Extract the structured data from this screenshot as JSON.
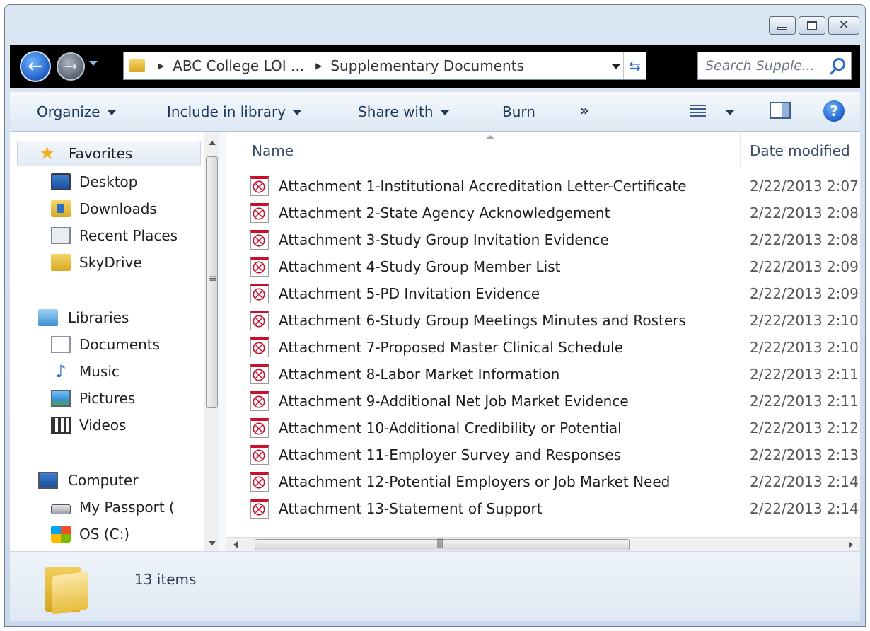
{
  "window": {
    "caption_buttons": [
      "minimize",
      "maximize",
      "close"
    ]
  },
  "address_bar": {
    "crumbs": [
      "ABC College LOI ...",
      "Supplementary Documents"
    ]
  },
  "search": {
    "placeholder": "Search Supple..."
  },
  "toolbar": {
    "organize": "Organize",
    "include_in_library": "Include in library",
    "share_with": "Share with",
    "burn": "Burn",
    "more": "»"
  },
  "navigation": {
    "favorites": "Favorites",
    "desktop": "Desktop",
    "downloads": "Downloads",
    "recent_places": "Recent Places",
    "skydrive": "SkyDrive",
    "libraries": "Libraries",
    "documents": "Documents",
    "music": "Music",
    "pictures": "Pictures",
    "videos": "Videos",
    "computer": "Computer",
    "my_passport": "My Passport (",
    "os_c": "OS (C:)"
  },
  "columns": {
    "name": "Name",
    "date_modified": "Date modified"
  },
  "files": [
    {
      "name": "Attachment 1-Institutional Accreditation Letter-Certificate",
      "date": "2/22/2013 2:07"
    },
    {
      "name": "Attachment 2-State Agency Acknowledgement",
      "date": "2/22/2013 2:08"
    },
    {
      "name": "Attachment 3-Study Group Invitation Evidence",
      "date": "2/22/2013 2:08"
    },
    {
      "name": "Attachment 4-Study Group Member List",
      "date": "2/22/2013 2:09"
    },
    {
      "name": "Attachment 5-PD Invitation Evidence",
      "date": "2/22/2013 2:09"
    },
    {
      "name": "Attachment 6-Study Group Meetings Minutes and Rosters",
      "date": "2/22/2013 2:10"
    },
    {
      "name": "Attachment 7-Proposed Master Clinical Schedule",
      "date": "2/22/2013 2:10"
    },
    {
      "name": "Attachment 8-Labor Market Information",
      "date": "2/22/2013 2:11"
    },
    {
      "name": "Attachment 9-Additional Net Job Market Evidence",
      "date": "2/22/2013 2:11"
    },
    {
      "name": "Attachment 10-Additional Credibility or Potential",
      "date": "2/22/2013 2:12"
    },
    {
      "name": "Attachment 11-Employer Survey and Responses",
      "date": "2/22/2013 2:13"
    },
    {
      "name": "Attachment 12-Potential Employers or Job Market Need",
      "date": "2/22/2013 2:14"
    },
    {
      "name": "Attachment 13-Statement of Support",
      "date": "2/22/2013 2:14"
    }
  ],
  "status": {
    "item_count": "13 items"
  },
  "colors": {
    "toolbar_text": "#1e395b",
    "pdf_red": "#c8102e",
    "address_band": "#000000"
  }
}
